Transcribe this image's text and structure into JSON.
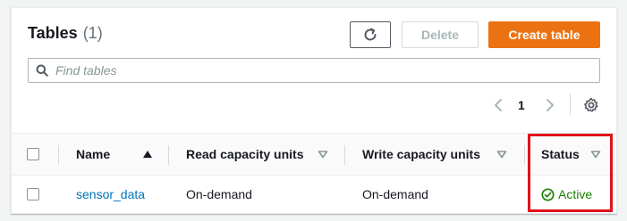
{
  "header": {
    "title": "Tables",
    "count": "(1)"
  },
  "toolbar": {
    "refresh_icon": "refresh-icon",
    "delete_label": "Delete",
    "create_label": "Create table"
  },
  "search": {
    "placeholder": "Find tables",
    "value": ""
  },
  "pagination": {
    "current_page": "1",
    "prev_icon": "chevron-left-icon",
    "next_icon": "chevron-right-icon",
    "settings_icon": "gear-icon"
  },
  "table": {
    "columns": [
      {
        "label": "Name",
        "sort": "ascending"
      },
      {
        "label": "Read capacity units",
        "sort": "none"
      },
      {
        "label": "Write capacity units",
        "sort": "none"
      },
      {
        "label": "Status",
        "sort": "none"
      }
    ],
    "rows": [
      {
        "name": "sensor_data",
        "read_capacity": "On-demand",
        "write_capacity": "On-demand",
        "status": "Active"
      }
    ]
  },
  "colors": {
    "accent": "#ec7211",
    "link": "#0073bb",
    "status_active": "#1d8102",
    "highlight": "#e0121a"
  }
}
